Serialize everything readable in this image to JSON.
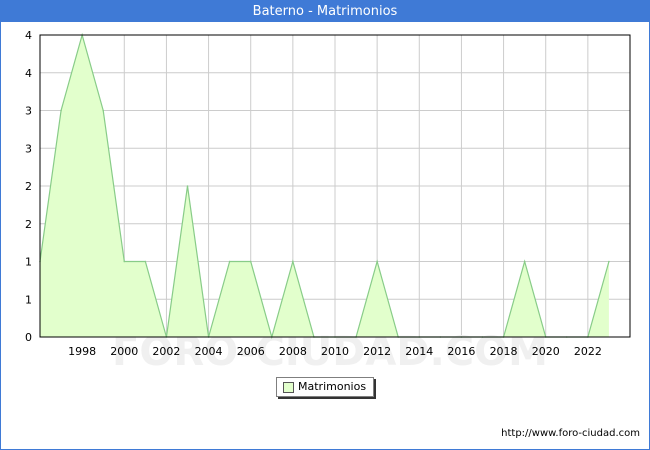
{
  "header": {
    "title": "Baterno - Matrimonios"
  },
  "source": "http://www.foro-ciudad.com",
  "watermark": "FORO-CIUDAD.COM",
  "colors": {
    "title_bar": "#3f7ad6",
    "area_fill": "#e2ffcc",
    "area_line": "#88cc88",
    "grid": "#cccccc"
  },
  "chart_data": {
    "type": "area",
    "title": "Baterno - Matrimonios",
    "xlabel": "",
    "ylabel": "",
    "x": [
      1996,
      1997,
      1998,
      1999,
      2000,
      2001,
      2002,
      2003,
      2004,
      2005,
      2006,
      2007,
      2008,
      2009,
      2010,
      2011,
      2012,
      2013,
      2014,
      2015,
      2016,
      2017,
      2018,
      2019,
      2020,
      2021,
      2022,
      2023
    ],
    "series": [
      {
        "name": "Matrimonios",
        "values": [
          1,
          3,
          4,
          3,
          1,
          1,
          0,
          2,
          0,
          1,
          1,
          0,
          1,
          0,
          0,
          0,
          1,
          0,
          0,
          0,
          0,
          0,
          0,
          1,
          0,
          0,
          0,
          1
        ]
      }
    ],
    "x_tick_labels": [
      "1998",
      "2000",
      "2002",
      "2004",
      "2006",
      "2008",
      "2010",
      "2012",
      "2014",
      "2016",
      "2018",
      "2020",
      "2022"
    ],
    "y_tick_labels": [
      "0",
      "1",
      "1",
      "2",
      "2",
      "3",
      "3",
      "4",
      "4"
    ],
    "xlim": [
      1996,
      2024
    ],
    "ylim": [
      0,
      4
    ],
    "grid": true,
    "legend": {
      "position": "bottom",
      "entries": [
        "Matrimonios"
      ]
    }
  }
}
